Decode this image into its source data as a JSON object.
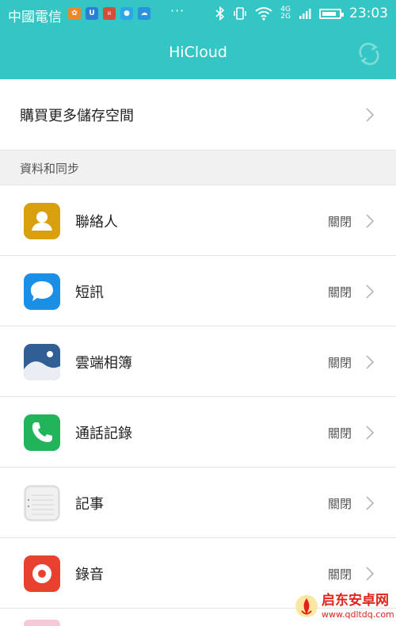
{
  "status_bar": {
    "carrier": "中國電信",
    "more": "···",
    "network": "4G\n2G",
    "time": "23:03",
    "battery_level": 0.85
  },
  "header": {
    "title": "HiCloud"
  },
  "buy_storage": {
    "label": "購買更多儲存空間"
  },
  "section": {
    "title": "資料和同步"
  },
  "items": [
    {
      "label": "聯絡人",
      "status": "關閉",
      "icon": "contacts-icon",
      "color": "#d9a00e"
    },
    {
      "label": "短訊",
      "status": "關閉",
      "icon": "messages-icon",
      "color": "#1a8fe6"
    },
    {
      "label": "雲端相簿",
      "status": "關閉",
      "icon": "gallery-icon",
      "color": "#2f5f95"
    },
    {
      "label": "通話記錄",
      "status": "關閉",
      "icon": "phone-icon",
      "color": "#21b45a"
    },
    {
      "label": "記事",
      "status": "關閉",
      "icon": "notepad-icon",
      "color": "#e6e6e6"
    },
    {
      "label": "錄音",
      "status": "關閉",
      "icon": "recorder-icon",
      "color": "#e8422f"
    }
  ],
  "watermark": {
    "name": "启东安卓网",
    "url": "www.qdltdq.com"
  }
}
